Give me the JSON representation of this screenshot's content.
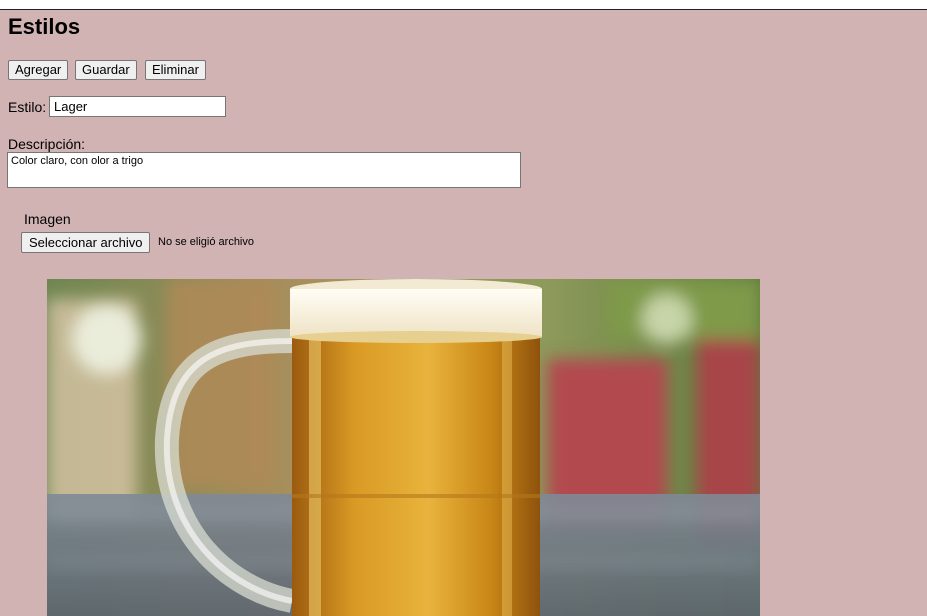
{
  "page": {
    "title": "Estilos",
    "background_color": "#d1b3b3"
  },
  "toolbar": {
    "add_label": "Agregar",
    "save_label": "Guardar",
    "delete_label": "Eliminar"
  },
  "form": {
    "style_label": "Estilo:",
    "style_value": "Lager",
    "description_label": "Descripción:",
    "description_value": "Color claro, con olor a trigo",
    "image_label": "Imagen",
    "file_button_label": "Seleccionar archivo",
    "file_status": "No se eligió archivo"
  },
  "image": {
    "subject": "beer-mug-photo"
  }
}
